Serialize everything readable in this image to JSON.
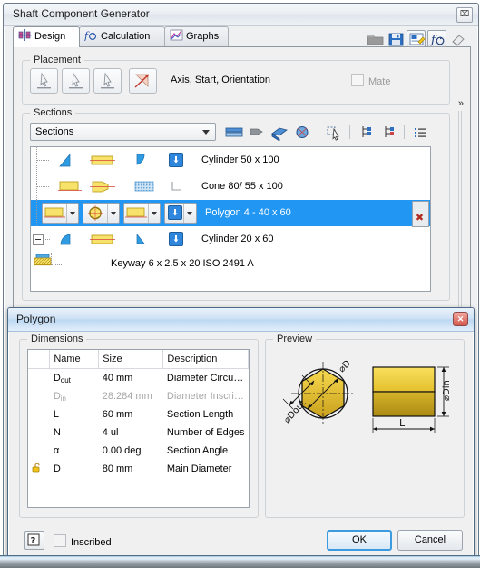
{
  "main_window": {
    "title": "Shaft Component Generator",
    "close_label": "⌧",
    "tabs": [
      {
        "label": "Design",
        "icon": "design-icon",
        "active": true
      },
      {
        "label": "Calculation",
        "icon": "fx-icon",
        "active": false
      },
      {
        "label": "Graphs",
        "icon": "graph-icon",
        "active": false
      }
    ],
    "top_tools": [
      {
        "name": "open-folder-icon"
      },
      {
        "name": "save-icon"
      },
      {
        "name": "edit-properties-icon"
      },
      {
        "name": "fx-calc-icon"
      },
      {
        "name": "eraser-icon"
      }
    ],
    "chevron_label": "»",
    "placement": {
      "legend": "Placement",
      "buttons": [
        "select-axis-button",
        "select-start-button",
        "select-orientation-button",
        "flip-button"
      ],
      "text": "Axis, Start, Orientation",
      "mate_label": "Mate"
    },
    "sections": {
      "legend": "Sections",
      "combo_value": "Sections",
      "tool_icons": [
        "insert-cylinder-icon",
        "insert-cone-icon",
        "insert-polygon-icon",
        "insert-section-icon",
        "pick-icon",
        "tree-left-icon",
        "tree-right-icon",
        "list-icon"
      ],
      "rows": [
        {
          "label": "Cylinder 50 x 100",
          "selected": false,
          "indent": 0
        },
        {
          "label": "Cone 80/ 55 x 100",
          "selected": false,
          "indent": 0
        },
        {
          "label": "Polygon 4 - 40 x 60",
          "selected": true,
          "indent": 0
        },
        {
          "label": "Cylinder 20 x 60",
          "selected": false,
          "indent": 0
        },
        {
          "label": "Keyway 6 x 2.5 x 20 ISO 2491 A",
          "selected": false,
          "indent": 1
        }
      ],
      "row_more_label": "…",
      "row_delete_label": "✖"
    }
  },
  "dialog": {
    "title": "Polygon",
    "close_label": "✕",
    "dimensions": {
      "legend": "Dimensions",
      "columns": [
        "",
        "Name",
        "Size",
        "Description"
      ],
      "rows": [
        {
          "name": "D",
          "sub": "out",
          "size": "40 mm",
          "description": "Diameter Circu…",
          "disabled": false,
          "lock": false
        },
        {
          "name": "D",
          "sub": "in",
          "size": "28.284 mm",
          "description": "Diameter Inscri…",
          "disabled": true,
          "lock": false
        },
        {
          "name": "L",
          "sub": "",
          "size": "60 mm",
          "description": "Section Length",
          "disabled": false,
          "lock": false
        },
        {
          "name": "N",
          "sub": "",
          "size": "4 ul",
          "description": "Number of Edges",
          "disabled": false,
          "lock": false
        },
        {
          "name": "α",
          "sub": "",
          "size": "0.00 deg",
          "description": "Section Angle",
          "disabled": false,
          "lock": false
        },
        {
          "name": "D",
          "sub": "",
          "size": "80 mm",
          "description": "Main Diameter",
          "disabled": false,
          "lock": true
        }
      ]
    },
    "preview": {
      "legend": "Preview",
      "labels": {
        "d_outer": "⌀Dout",
        "d_circum": "⌀D",
        "d_in": "⌀Din",
        "length": "L"
      }
    },
    "footer": {
      "help_label": "?",
      "inscribed_label": "Inscribed",
      "ok_label": "OK",
      "cancel_label": "Cancel"
    }
  },
  "colors": {
    "selection_blue": "#2196f3",
    "title_blue": "#bcd8f2",
    "gold": "#f2cb3a",
    "gold_dark": "#bfa024",
    "accent_border": "#4d6a86"
  }
}
